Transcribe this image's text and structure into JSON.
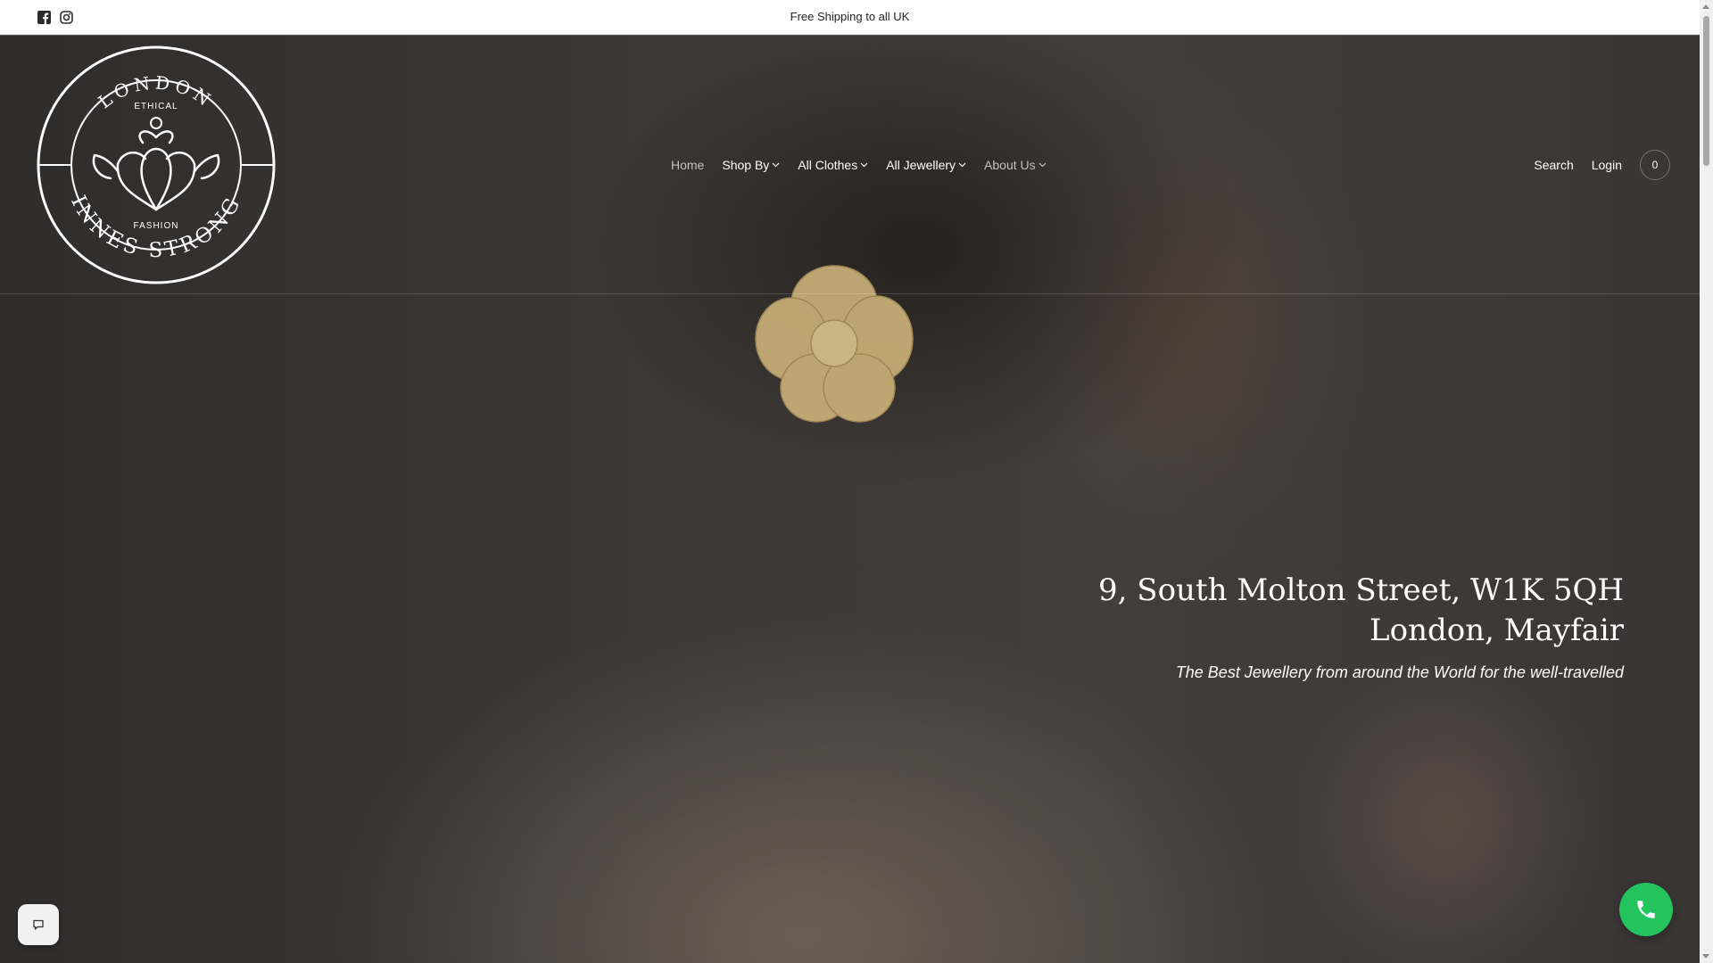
{
  "announcement": {
    "text": "Free Shipping to all UK",
    "social": [
      "facebook-icon",
      "instagram-icon"
    ]
  },
  "logo": {
    "top_text": "LONDON",
    "inner_top": "ETHICAL",
    "inner_bottom": "FASHION",
    "bottom_text": "INNES STRONG"
  },
  "nav": {
    "items": [
      {
        "label": "Home",
        "dropdown": false
      },
      {
        "label": "Shop By",
        "dropdown": true
      },
      {
        "label": "All Clothes",
        "dropdown": true
      },
      {
        "label": "All Jewellery",
        "dropdown": true
      },
      {
        "label": "About Us",
        "dropdown": true
      }
    ]
  },
  "utility": {
    "search": "Search",
    "login": "Login",
    "cart_count": "0"
  },
  "hero": {
    "headline_line1": "9, South Molton Street, W1K 5QH",
    "headline_line2": "London, Mayfair",
    "tagline": "The Best Jewellery from around the World for the well-travelled"
  },
  "widgets": {
    "chat": "chat-bubble-icon",
    "call": "phone-icon"
  },
  "colors": {
    "call_button": "#23c45e",
    "announcement_bg": "#ffffff",
    "text_light": "#ffffff"
  }
}
